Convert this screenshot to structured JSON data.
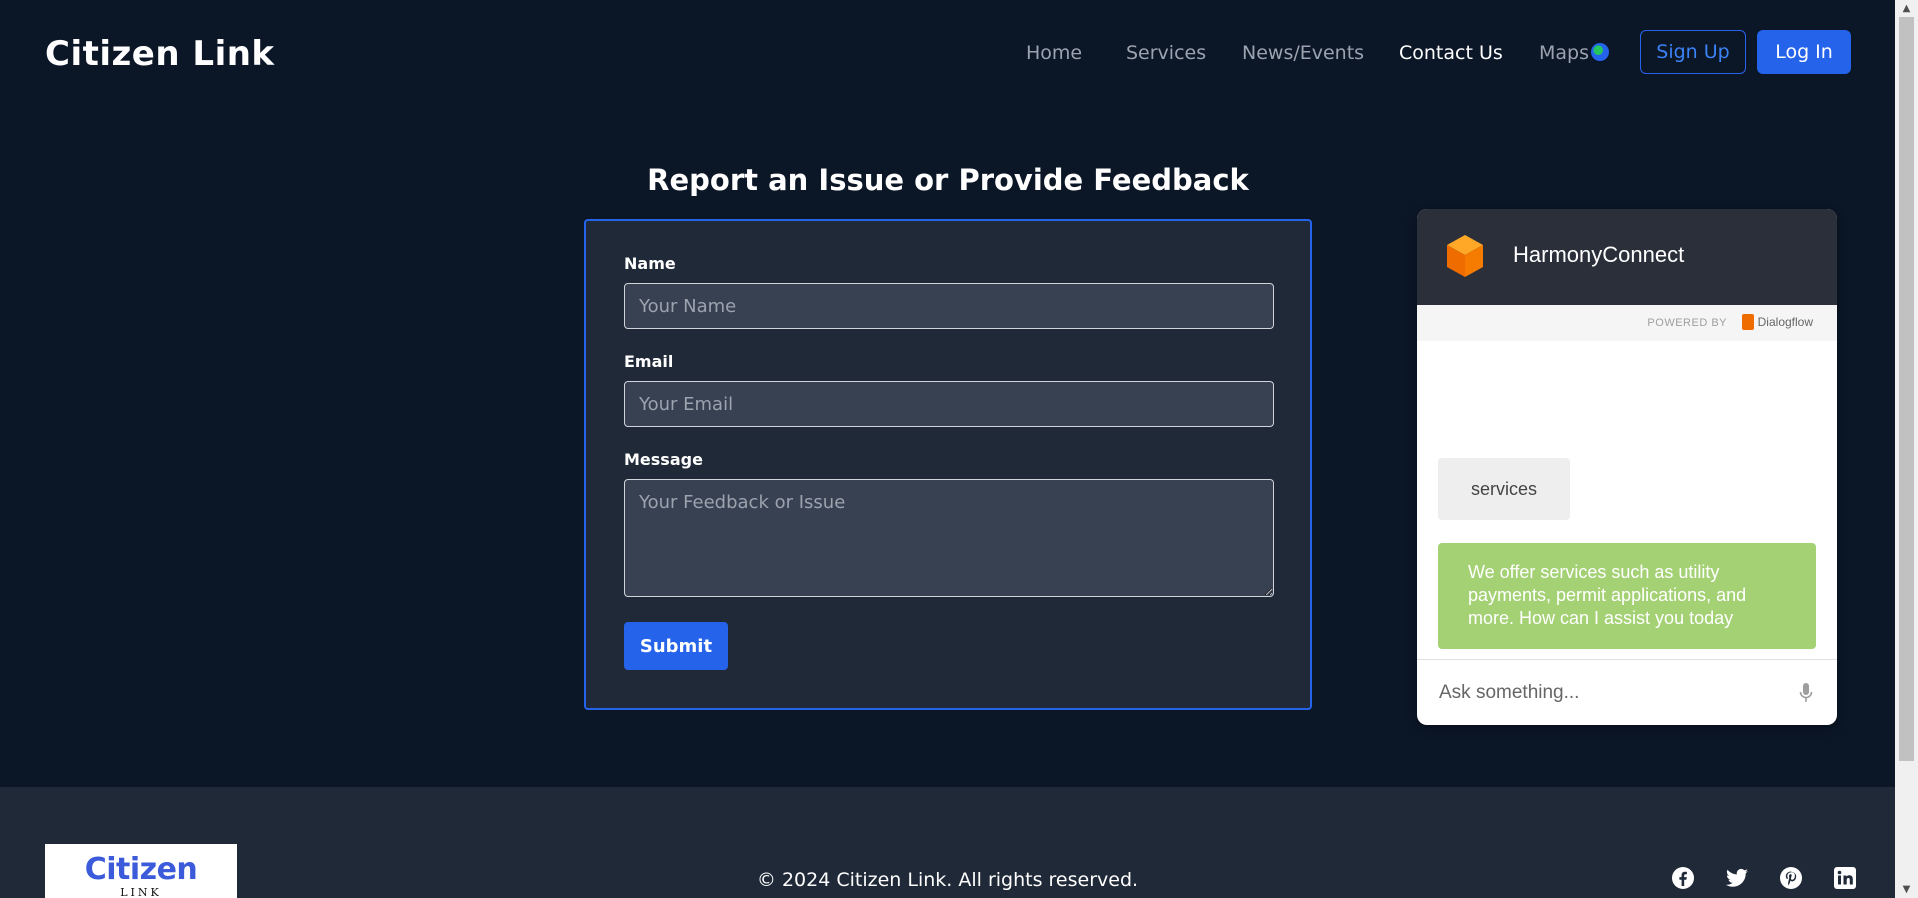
{
  "header": {
    "logo": "Citizen Link",
    "nav": [
      {
        "label": "Home"
      },
      {
        "label": "Services"
      },
      {
        "label": "News/Events"
      },
      {
        "label": "Contact Us"
      },
      {
        "label": "Maps"
      }
    ],
    "signup_label": "Sign Up",
    "login_label": "Log In"
  },
  "form": {
    "title": "Report an Issue or Provide Feedback",
    "name_label": "Name",
    "name_placeholder": "Your Name",
    "email_label": "Email",
    "email_placeholder": "Your Email",
    "message_label": "Message",
    "message_placeholder": "Your Feedback or Issue",
    "submit_label": "Submit"
  },
  "chat": {
    "title": "HarmonyConnect",
    "powered_by": "POWERED BY",
    "provider": "Dialogflow",
    "user_message": "services",
    "bot_message": "We offer services such as utility payments, permit applications, and more. How can I assist you today",
    "input_placeholder": "Ask something..."
  },
  "footer": {
    "logo_main": "Citizen",
    "logo_sub": "LINK",
    "copyright": "© 2024 Citizen Link. All rights reserved.",
    "socials": [
      "facebook-icon",
      "twitter-icon",
      "pinterest-icon",
      "linkedin-icon"
    ]
  },
  "colors": {
    "background": "#0b1627",
    "card": "#1f2937",
    "accent": "#2563eb",
    "bot_bubble": "#a5d175"
  }
}
